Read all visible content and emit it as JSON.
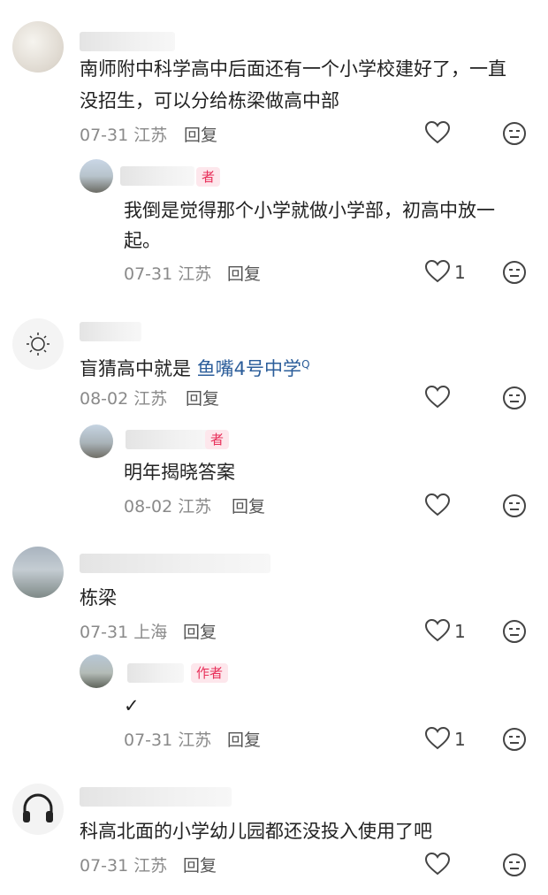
{
  "comments": [
    {
      "text_line1": "南师附中科学高中后面还有一个小学校建好了，一直",
      "text_line2": "没招生，可以分给栋梁做高中部",
      "date": "07-31",
      "location": "江苏",
      "reply_label": "回复",
      "likes": "",
      "reply": {
        "badge": "作者",
        "text_line1": "我倒是觉得那个小学就做小学部，初高中放一",
        "text_line2": "起。",
        "date": "07-31",
        "location": "江苏",
        "reply_label": "回复",
        "likes": "1"
      }
    },
    {
      "text_prefix": "盲猜高中就是 ",
      "text_link": "鱼嘴4号中学",
      "link_mark": "Q",
      "date": "08-02",
      "location": "江苏",
      "reply_label": "回复",
      "likes": "",
      "reply": {
        "badge": "者",
        "text_line1": "明年揭晓答案",
        "date": "08-02",
        "location": "江苏",
        "reply_label": "回复",
        "likes": ""
      }
    },
    {
      "text_line1": "栋梁",
      "date": "07-31",
      "location": "上海",
      "reply_label": "回复",
      "likes": "1",
      "reply": {
        "badge": "作者",
        "text_line1": "✓",
        "date": "07-31",
        "location": "江苏",
        "reply_label": "回复",
        "likes": "1"
      }
    },
    {
      "text_line1": "科高北面的小学幼儿园都还没投入使用了吧",
      "date": "07-31",
      "location": "江苏",
      "reply_label": "回复",
      "likes": ""
    }
  ],
  "first_reply_badge": "者",
  "colors": {
    "author_badge": "#e8305a",
    "link": "#2b5d9a"
  }
}
